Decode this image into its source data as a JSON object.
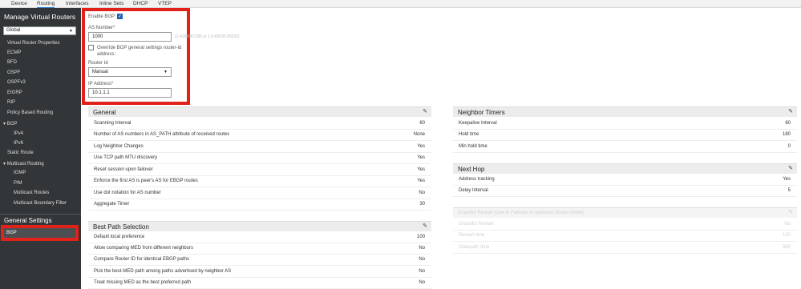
{
  "tabs": [
    "Device",
    "Routing",
    "Interfaces",
    "Inline Sets",
    "DHCP",
    "VTEP"
  ],
  "sidebar": {
    "title": "Manage Virtual Routers",
    "router_select": "Global",
    "items": [
      "Virtual Router Properties",
      "ECMP",
      "BFD",
      "OSPF",
      "OSPFv3",
      "EIGRP",
      "RIP",
      "Policy Based Routing",
      "BGP",
      "IPv4",
      "IPv6",
      "Static Route",
      "Multicast Routing",
      "IGMP",
      "PIM",
      "Multicast Routes",
      "Multicast Boundary Filter"
    ],
    "general_settings": "General Settings",
    "selected": "BGP"
  },
  "form": {
    "enable_label": "Enable BGP:",
    "enabled": true,
    "as_label": "AS Number*",
    "as_value": "1000",
    "as_hint": "(1-4294967295 or 1.0-65535.65535)",
    "override_label_1": "Override BGP general settings router-id",
    "override_label_2": "address:",
    "override_checked": false,
    "router_id_label": "Router Id",
    "router_id_value": "Manual",
    "ip_label": "IP Address*",
    "ip_value": "10.1.1.1"
  },
  "general": {
    "title": "General",
    "rows": [
      {
        "k": "Scanning Interval",
        "v": "60"
      },
      {
        "k": "Number of AS numbers in AS_PATH attribute of received routes",
        "v": "None"
      },
      {
        "k": "Log Neighbor Changes",
        "v": "Yes"
      },
      {
        "k": "Use TCP path MTU discovery",
        "v": "Yes"
      },
      {
        "k": "Reset session upon failover",
        "v": "Yes"
      },
      {
        "k": "Enforce the first AS is peer's AS for EBGP routes",
        "v": "Yes"
      },
      {
        "k": "Use dot notation for AS number",
        "v": "No"
      },
      {
        "k": "Aggregate Timer",
        "v": "30"
      }
    ]
  },
  "best_path": {
    "title": "Best Path Selection",
    "rows": [
      {
        "k": "Default local preference",
        "v": "100"
      },
      {
        "k": "Allow comparing MED from different neighbors",
        "v": "No"
      },
      {
        "k": "Compare Router ID for identical EBGP paths",
        "v": "No"
      },
      {
        "k": "Pick the best-MED path among paths advertised by neighbor AS",
        "v": "No"
      },
      {
        "k": "Treat missing MED as the best preferred path",
        "v": "No"
      }
    ]
  },
  "neighbor_timers": {
    "title": "Neighbor Timers",
    "rows": [
      {
        "k": "Keepalive Interval",
        "v": "60"
      },
      {
        "k": "Hold time",
        "v": "180"
      },
      {
        "k": "Min hold time",
        "v": "0"
      }
    ]
  },
  "next_hop": {
    "title": "Next Hop",
    "rows": [
      {
        "k": "Address tracking",
        "v": "Yes"
      },
      {
        "k": "Delay Interval",
        "v": "5"
      }
    ]
  },
  "graceful": {
    "title": "Graceful Restart (Use in Failover or spanned cluster mode)",
    "rows": [
      {
        "k": "Graceful Restart",
        "v": "No"
      },
      {
        "k": "Restart time",
        "v": "120"
      },
      {
        "k": "Stalepath time",
        "v": "360"
      }
    ]
  },
  "colors": {
    "highlight": "#e0221a",
    "sidebar": "#333638",
    "checkbox": "#1f63b6"
  }
}
